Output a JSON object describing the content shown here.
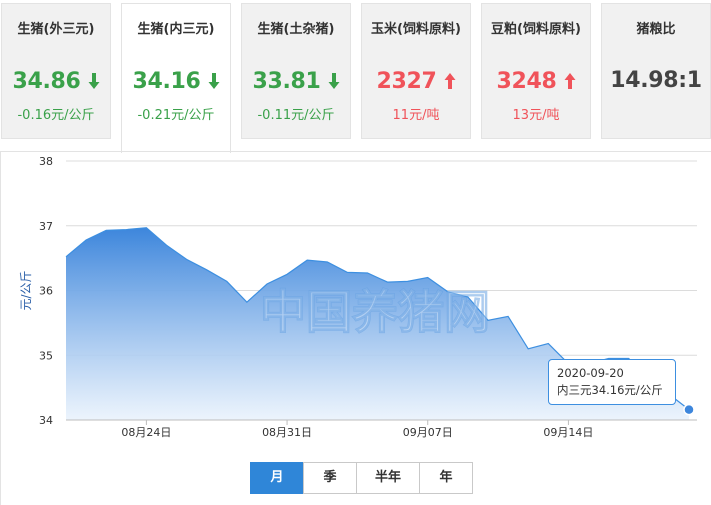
{
  "cards": [
    {
      "title": "生猪(外三元)",
      "value": "34.86",
      "change": "-0.16元/公斤",
      "trend": "down"
    },
    {
      "title": "生猪(内三元)",
      "value": "34.16",
      "change": "-0.21元/公斤",
      "trend": "down"
    },
    {
      "title": "生猪(土杂猪)",
      "value": "33.81",
      "change": "-0.11元/公斤",
      "trend": "down"
    },
    {
      "title": "玉米(饲料原料)",
      "value": "2327",
      "change": "11元/吨",
      "trend": "up"
    },
    {
      "title": "豆粕(饲料原料)",
      "value": "3248",
      "change": "13元/吨",
      "trend": "up"
    },
    {
      "title": "猪粮比",
      "value": "14.98:1",
      "change": "",
      "trend": "none"
    }
  ],
  "colors": {
    "down": "#3aa14a",
    "up": "#f0535a",
    "accent": "#2f86d8",
    "line": "#3d8fe0"
  },
  "icons": {
    "down": "arrow-down-icon",
    "up": "arrow-up-icon"
  },
  "chart_data": {
    "type": "area",
    "ylabel": "元/公斤",
    "ylim": [
      34,
      38
    ],
    "yticks": [
      34,
      35,
      36,
      37,
      38
    ],
    "grid": true,
    "x_dates": [
      "2020-08-20",
      "2020-08-21",
      "2020-08-22",
      "2020-08-23",
      "2020-08-24",
      "2020-08-25",
      "2020-08-26",
      "2020-08-27",
      "2020-08-28",
      "2020-08-29",
      "2020-08-30",
      "2020-08-31",
      "2020-09-01",
      "2020-09-02",
      "2020-09-03",
      "2020-09-04",
      "2020-09-05",
      "2020-09-06",
      "2020-09-07",
      "2020-09-08",
      "2020-09-09",
      "2020-09-10",
      "2020-09-11",
      "2020-09-12",
      "2020-09-13",
      "2020-09-14",
      "2020-09-15",
      "2020-09-16",
      "2020-09-17",
      "2020-09-18",
      "2020-09-19",
      "2020-09-20"
    ],
    "x_ticks": [
      {
        "date": "2020-08-24",
        "label": "08月24日"
      },
      {
        "date": "2020-08-31",
        "label": "08月31日"
      },
      {
        "date": "2020-09-07",
        "label": "09月07日"
      },
      {
        "date": "2020-09-14",
        "label": "09月14日"
      }
    ],
    "series": [
      {
        "values": [
          36.52,
          36.78,
          36.93,
          36.94,
          36.97,
          36.7,
          36.48,
          36.32,
          36.14,
          35.82,
          36.1,
          36.25,
          36.47,
          36.44,
          36.28,
          36.27,
          36.13,
          36.14,
          36.2,
          35.98,
          35.9,
          35.54,
          35.6,
          35.1,
          35.18,
          34.87,
          34.87,
          34.95,
          34.95,
          34.65,
          34.4,
          34.16
        ]
      }
    ],
    "tooltip": {
      "date": "2020-09-20",
      "label": "内三元34.16元/公斤"
    }
  },
  "watermark": "中国养猪网",
  "range_tabs": [
    {
      "label": "月",
      "active": true
    },
    {
      "label": "季",
      "active": false
    },
    {
      "label": "半年",
      "active": false
    },
    {
      "label": "年",
      "active": false
    }
  ]
}
